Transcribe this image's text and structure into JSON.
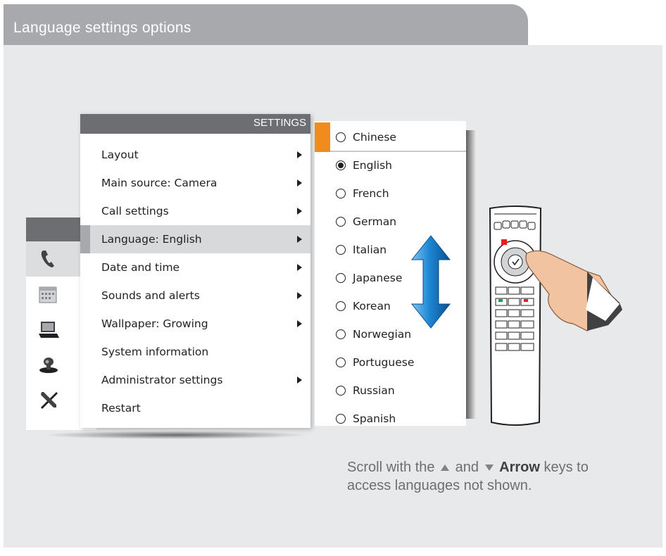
{
  "page": {
    "title": "Language settings options"
  },
  "side_menu": {
    "items": [
      {
        "icon": "phone-icon",
        "active": true
      },
      {
        "icon": "calendar-icon",
        "active": false
      },
      {
        "icon": "laptop-icon",
        "active": false
      },
      {
        "icon": "camera-icon",
        "active": false
      },
      {
        "icon": "tools-icon",
        "active": false
      }
    ]
  },
  "settings_menu": {
    "header": "SETTINGS",
    "items": [
      {
        "label": "Layout",
        "has_submenu": true
      },
      {
        "label": "Main source: Camera",
        "has_submenu": true
      },
      {
        "label": "Call settings",
        "has_submenu": true
      },
      {
        "label": "Language: English",
        "has_submenu": true,
        "active": true
      },
      {
        "label": "Date and time",
        "has_submenu": true
      },
      {
        "label": "Sounds and alerts",
        "has_submenu": true
      },
      {
        "label": "Wallpaper: Growing",
        "has_submenu": true
      },
      {
        "label": "System information",
        "has_submenu": false
      },
      {
        "label": "Administrator settings",
        "has_submenu": true
      },
      {
        "label": "Restart",
        "has_submenu": false
      }
    ]
  },
  "language_list": {
    "selected": "English",
    "focused": "Chinese",
    "items": [
      "Chinese",
      "English",
      "French",
      "German",
      "Italian",
      "Japanese",
      "Korean",
      "Norwegian",
      "Portuguese",
      "Russian",
      "Spanish"
    ]
  },
  "caption": {
    "prefix": "Scroll with the",
    "middle": "and",
    "bold": "Arrow",
    "suffix": "keys to access languages not shown."
  },
  "colors": {
    "accent": "#f08c1e",
    "header": "#6d6e71",
    "tab": "#a7a9ac",
    "panel": "#e8e9ea",
    "scroll_arrow": "#1e88d4"
  }
}
